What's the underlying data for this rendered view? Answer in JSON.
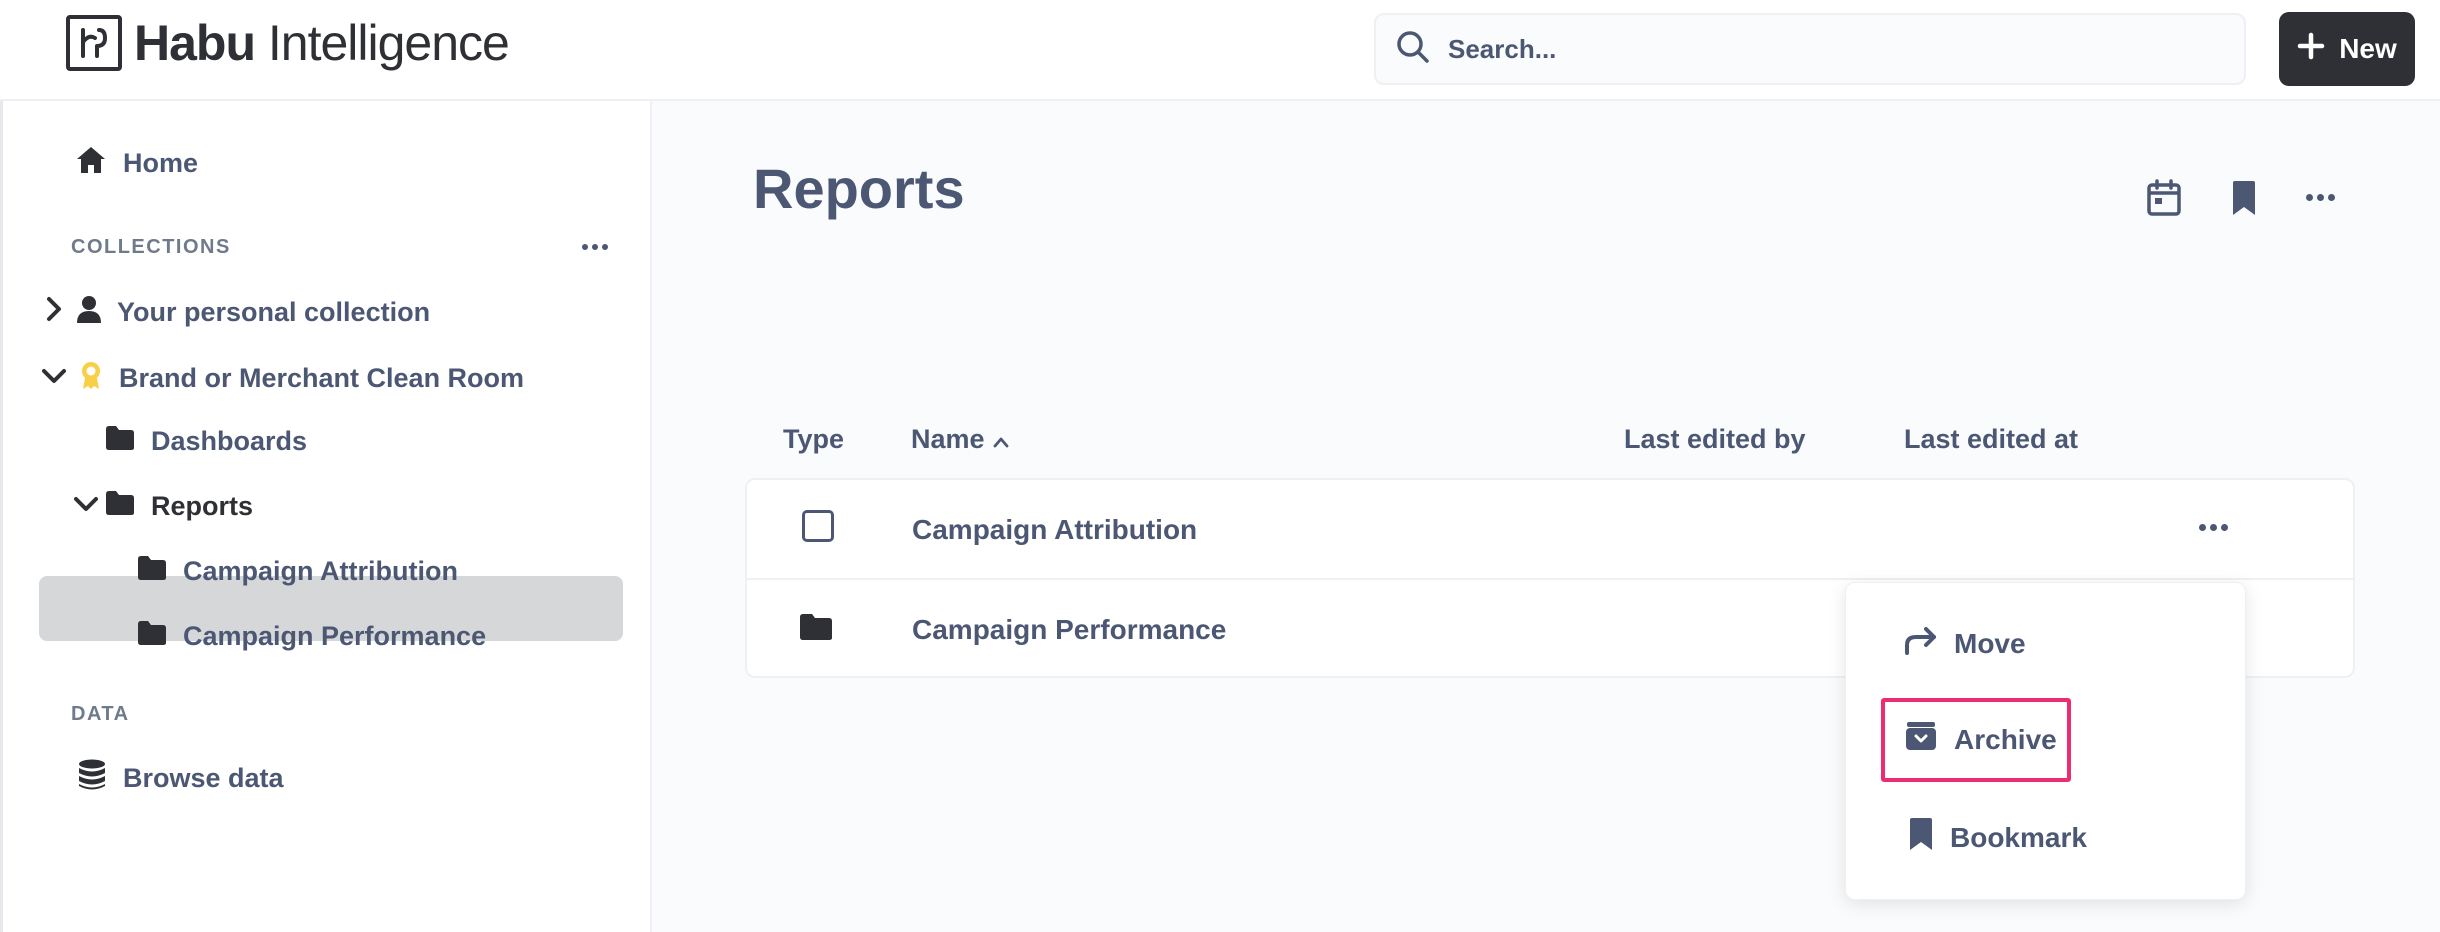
{
  "header": {
    "logo_bold": "Habu",
    "logo_rest": " Intelligence",
    "search_placeholder": "Search...",
    "new_label": "New"
  },
  "sidebar": {
    "home_label": "Home",
    "collections_label": "COLLECTIONS",
    "personal_collection": "Your personal collection",
    "clean_room": "Brand or Merchant Clean Room",
    "dashboards": "Dashboards",
    "reports": "Reports",
    "campaign_attribution": "Campaign Attribution",
    "campaign_performance": "Campaign Performance",
    "data_label": "DATA",
    "browse_data": "Browse data"
  },
  "main": {
    "title": "Reports",
    "columns": {
      "type": "Type",
      "name": "Name",
      "last_edited_by": "Last edited by",
      "last_edited_at": "Last edited at"
    },
    "rows": [
      {
        "name": "Campaign Attribution",
        "type_icon": "checkbox"
      },
      {
        "name": "Campaign Performance",
        "type_icon": "folder-icon"
      }
    ]
  },
  "menu": {
    "move": "Move",
    "archive": "Archive",
    "bookmark": "Bookmark"
  },
  "colors": {
    "text": "#4c5773",
    "dark": "#2e3035",
    "highlight": "#ec2d73",
    "badge": "#f9cf48"
  }
}
